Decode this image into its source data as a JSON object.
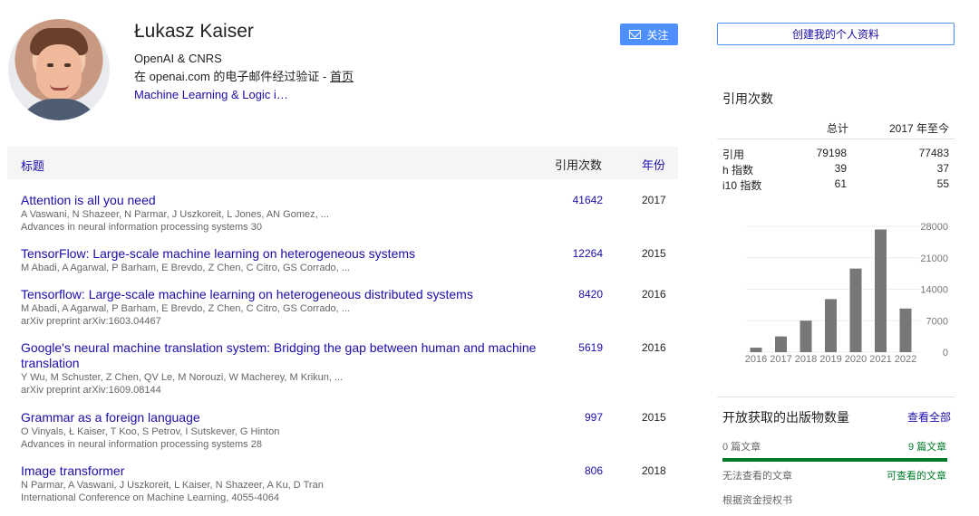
{
  "profile": {
    "name": "Łukasz Kaiser",
    "affiliation": "OpenAI & CNRS",
    "verification_prefix": "在 openai.com 的电子邮件经过验证 - ",
    "homepage_label": "首页",
    "interests": "Machine Learning & Logic i…",
    "follow_label": "关注",
    "create_profile_label": "创建我的个人资料"
  },
  "table": {
    "headers": {
      "title": "标题",
      "citations": "引用次数",
      "year": "年份"
    },
    "rows": [
      {
        "title": "Attention is all you need",
        "authors": "A Vaswani, N Shazeer, N Parmar, J Uszkoreit, L Jones, AN Gomez, ...",
        "venue": "Advances in neural information processing systems 30",
        "citations": "41642",
        "year": "2017"
      },
      {
        "title": "TensorFlow: Large-scale machine learning on heterogeneous systems",
        "authors": "M Abadi, A Agarwal, P Barham, E Brevdo, Z Chen, C Citro, GS Corrado, ...",
        "venue": "",
        "citations": "12264",
        "year": "2015"
      },
      {
        "title": "Tensorflow: Large-scale machine learning on heterogeneous distributed systems",
        "authors": "M Abadi, A Agarwal, P Barham, E Brevdo, Z Chen, C Citro, GS Corrado, ...",
        "venue": "arXiv preprint arXiv:1603.04467",
        "citations": "8420",
        "year": "2016"
      },
      {
        "title": "Google's neural machine translation system: Bridging the gap between human and machine translation",
        "authors": "Y Wu, M Schuster, Z Chen, QV Le, M Norouzi, W Macherey, M Krikun, ...",
        "venue": "arXiv preprint arXiv:1609.08144",
        "citations": "5619",
        "year": "2016"
      },
      {
        "title": "Grammar as a foreign language",
        "authors": "O Vinyals, Ł Kaiser, T Koo, S Petrov, I Sutskever, G Hinton",
        "venue": "Advances in neural information processing systems 28",
        "citations": "997",
        "year": "2015"
      },
      {
        "title": "Image transformer",
        "authors": "N Parmar, A Vaswani, J Uszkoreit, L Kaiser, N Shazeer, A Ku, D Tran",
        "venue": "International Conference on Machine Learning, 4055-4064",
        "citations": "806",
        "year": "2018"
      }
    ]
  },
  "metrics": {
    "title": "引用次数",
    "column_total": "总计",
    "column_since": "2017 年至今",
    "rows": [
      {
        "label": "引用",
        "all": "79198",
        "recent": "77483"
      },
      {
        "label": "h 指数",
        "all": "39",
        "recent": "37"
      },
      {
        "label": "i10 指数",
        "all": "61",
        "recent": "55"
      }
    ]
  },
  "chart_data": {
    "type": "bar",
    "categories": [
      "2016",
      "2017",
      "2018",
      "2019",
      "2020",
      "2021",
      "2022"
    ],
    "values": [
      1000,
      3500,
      7000,
      11800,
      18600,
      27300,
      9700
    ],
    "ylim": [
      0,
      28000
    ],
    "y_ticks": [
      0,
      7000,
      14000,
      21000,
      28000
    ],
    "grid": true,
    "bar_color": "#777777"
  },
  "open_access": {
    "title": "开放获取的出版物数量",
    "view_all": "查看全部",
    "not_available_count": "0 篇文章",
    "available_count": "9 篇文章",
    "not_available_label": "无法查看的文章",
    "available_label": "可查看的文章",
    "funding_label": "根据资金授权书",
    "available_fraction": 1
  },
  "colors": {
    "link": "#1a0dab",
    "follow_button": "#4d90fe",
    "open_access_green": "#007a28"
  }
}
